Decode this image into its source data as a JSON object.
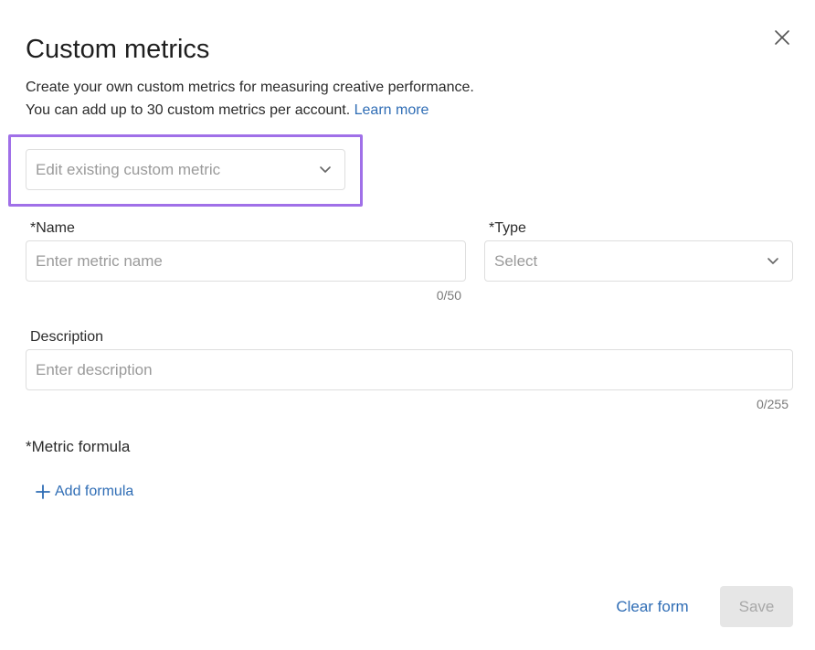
{
  "dialog": {
    "title": "Custom metrics",
    "subtitle_line1": "Create your own custom metrics for measuring creative performance.",
    "subtitle_line2": "You can add up to 30 custom metrics per account.",
    "learn_more": "Learn more",
    "close_icon": "close-icon"
  },
  "edit_existing": {
    "placeholder": "Edit existing custom metric",
    "icon": "chevron-down-icon"
  },
  "name_field": {
    "label": "*Name",
    "placeholder": "Enter metric name",
    "counter": "0/50"
  },
  "type_field": {
    "label": "*Type",
    "placeholder": "Select",
    "icon": "chevron-down-icon"
  },
  "description_field": {
    "label": "Description",
    "placeholder": "Enter description",
    "counter": "0/255"
  },
  "formula": {
    "label": "*Metric formula",
    "add_label": "Add formula",
    "add_icon": "plus-icon"
  },
  "footer": {
    "clear_label": "Clear form",
    "save_label": "Save"
  },
  "colors": {
    "accent": "#2f6db5",
    "highlight": "#a070e8",
    "disabled_bg": "#e6e6e6"
  }
}
